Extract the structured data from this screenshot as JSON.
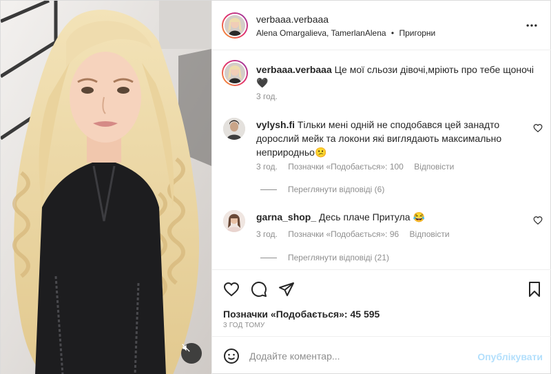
{
  "post": {
    "media": {
      "alt": "",
      "mute_icon": "speaker-muted-icon"
    },
    "header": {
      "username": "verbaaa.verbaaa",
      "collaborators": "Alena Omargalieva, TamerlanAlena",
      "separator": "•",
      "location": "Пригорни",
      "more_icon": "more-horizontal-icon"
    },
    "caption": {
      "username": "verbaaa.verbaaa",
      "text": "Це мої сльози дівочі,мріють про тебе щоночі 🖤",
      "time": "3 год."
    },
    "comments": [
      {
        "username": "vylysh.fi",
        "text": "Тільки мені одній не сподобався цей занадто дорослий мейк та локони які виглядають максимально неприродньо😕",
        "time": "3 год.",
        "likes": "Позначки «Подобається»: 100",
        "reply": "Відповісти",
        "view_replies": "Переглянути відповіді (6)"
      },
      {
        "username": "garna_shop_",
        "text": "Десь плаче Притула 😂",
        "time": "3 год.",
        "likes": "Позначки «Подобається»: 96",
        "reply": "Відповісти",
        "view_replies": "Переглянути відповіді (21)"
      }
    ],
    "actions": {
      "like_icon": "heart-icon",
      "comment_icon": "comment-bubble-icon",
      "share_icon": "paper-plane-icon",
      "save_icon": "bookmark-icon"
    },
    "likes_text": "Позначки «Подобається»: 45 595",
    "time_ago": "3 ГОД ТОМУ",
    "add_comment": {
      "emoji_icon": "smiley-icon",
      "placeholder": "Додайте коментар...",
      "publish_label": "Опублікувати"
    },
    "colors": {
      "text": "#262626",
      "secondary": "#8e8e8e",
      "publish_disabled": "#b2dffc",
      "divider": "#efefef"
    }
  }
}
